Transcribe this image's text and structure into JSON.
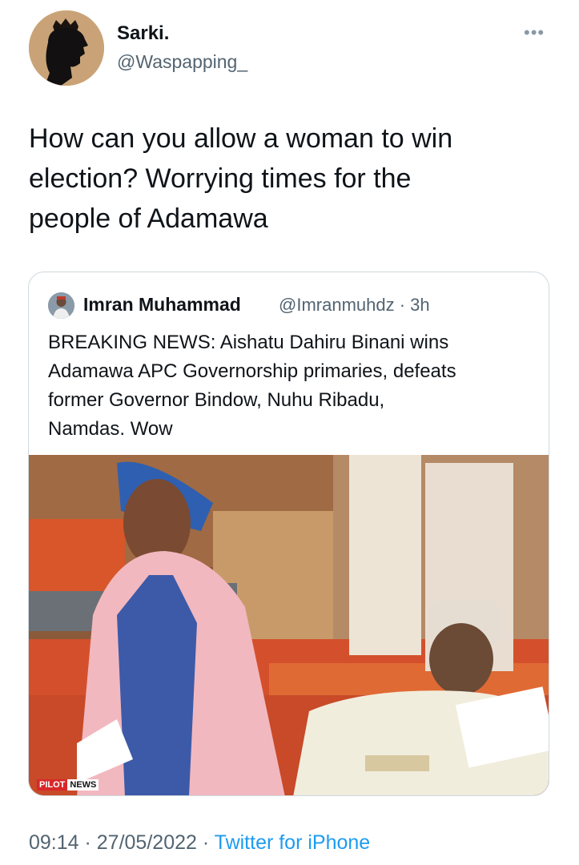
{
  "tweet": {
    "display_name": "Sarki.",
    "handle": "@Waspapping_",
    "more_icon": "more-options-icon",
    "text_lines": [
      "How can you allow a woman to win",
      "election? Worrying times for the",
      "people of Adamawa"
    ],
    "date": "09:14 · 27/05/2022 ·",
    "source": "Twitter for iPhone"
  },
  "quote": {
    "display_name": "Imran Muhammad",
    "handle_time": "@Imranmuhdz · 3h",
    "text_lines": [
      "BREAKING NEWS: Aishatu Dahiru Binani wins",
      "Adamawa APC Governorship primaries, defeats",
      "former Governor Bindow, Nuhu Ribadu,",
      "Namdas. Wow"
    ],
    "watermark_red": "PILOT",
    "watermark_white": "NEWS"
  },
  "colors": {
    "text_primary": "#0f1419",
    "text_secondary": "#536471",
    "link": "#1d9bf0",
    "border": "#cfd9de"
  }
}
